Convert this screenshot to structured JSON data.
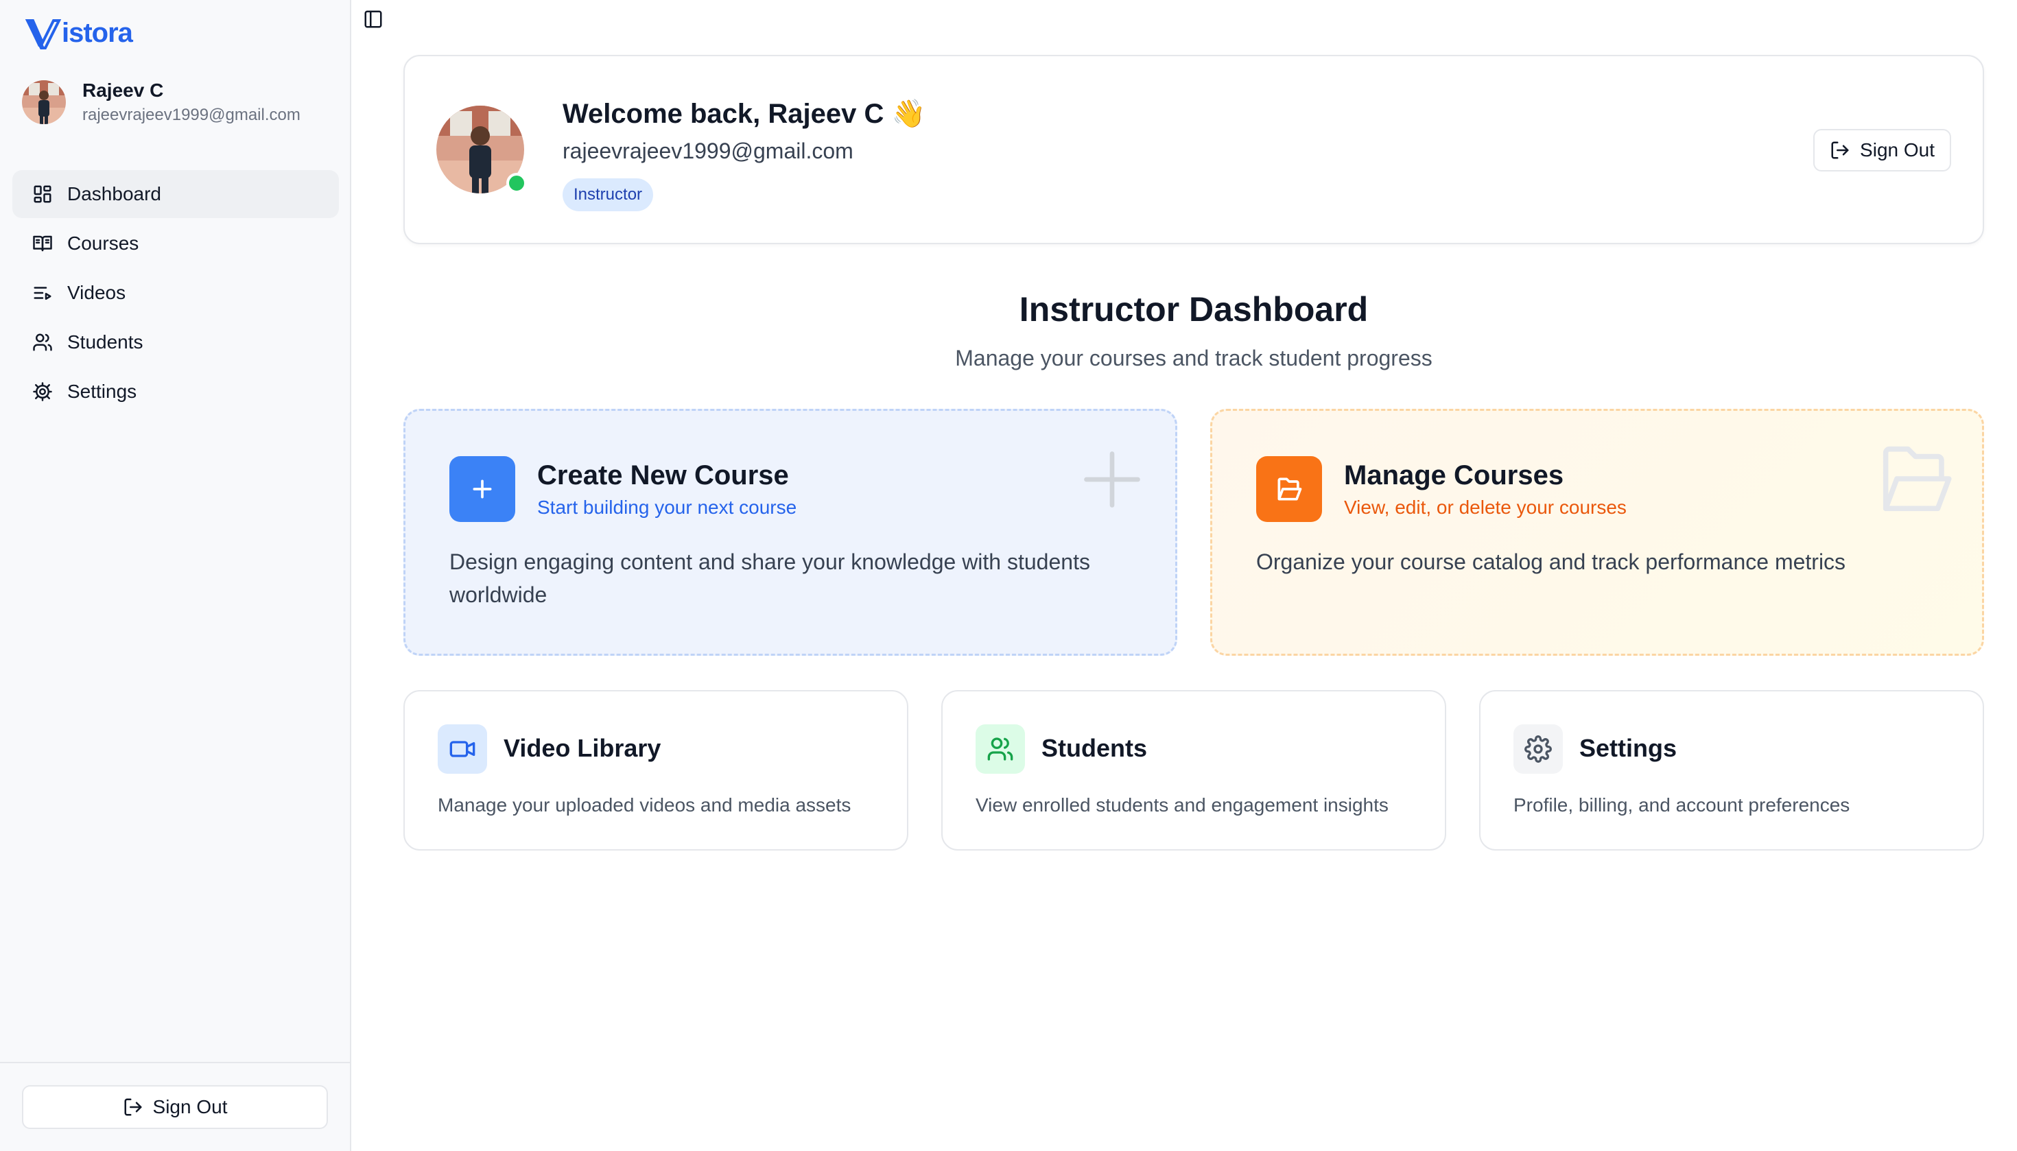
{
  "app": {
    "logo_text": "istora",
    "brand_color": "#2563eb"
  },
  "user": {
    "name": "Rajeev C",
    "email": "rajeevrajeev1999@gmail.com",
    "role": "Instructor"
  },
  "sidebar": {
    "items": [
      {
        "label": "Dashboard",
        "icon": "dashboard-icon",
        "active": true
      },
      {
        "label": "Courses",
        "icon": "book-open-icon"
      },
      {
        "label": "Videos",
        "icon": "list-video-icon"
      },
      {
        "label": "Students",
        "icon": "users-icon"
      },
      {
        "label": "Settings",
        "icon": "gear-icon"
      }
    ],
    "signout_label": "Sign Out"
  },
  "header": {
    "welcome": "Welcome back, Rajeev C 👋",
    "email": "rajeevrajeev1999@gmail.com",
    "badge": "Instructor",
    "signout_label": "Sign Out"
  },
  "dashboard": {
    "title": "Instructor Dashboard",
    "subtitle": "Manage your courses and track student progress"
  },
  "cards": {
    "create": {
      "title": "Create New Course",
      "subtitle": "Start building your next course",
      "description": "Design engaging content and share your knowledge with students worldwide"
    },
    "manage": {
      "title": "Manage Courses",
      "subtitle": "View, edit, or delete your courses",
      "description": "Organize your course catalog and track performance metrics"
    },
    "videos": {
      "title": "Video Library",
      "description": "Manage your uploaded videos and media assets"
    },
    "students": {
      "title": "Students",
      "description": "View enrolled students and engagement insights"
    },
    "settings": {
      "title": "Settings",
      "description": "Profile, billing, and account preferences"
    }
  }
}
